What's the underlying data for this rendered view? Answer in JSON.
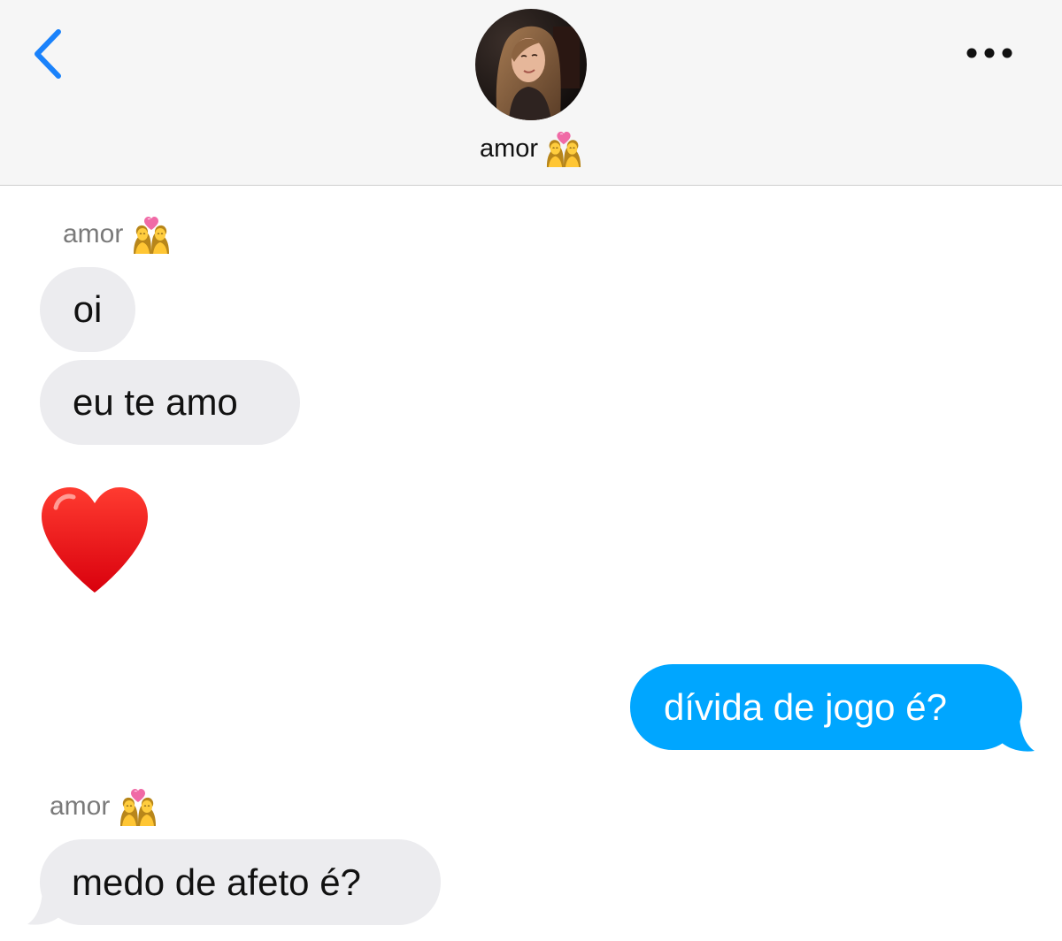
{
  "header": {
    "contact_name": "amor",
    "contact_emoji": "couple-with-heart-women-icon",
    "back_icon": "chevron-left-icon",
    "more_icon": "ellipsis-icon",
    "accent_color": "#1a82fb"
  },
  "messages": [
    {
      "sender": "amor",
      "direction": "incoming",
      "text": "oi"
    },
    {
      "sender": "amor",
      "direction": "incoming",
      "text": "eu te amo"
    },
    {
      "sender": "amor",
      "direction": "incoming",
      "emoji": "red-heart-icon"
    },
    {
      "sender": "me",
      "direction": "outgoing",
      "text": "dívida de jogo é?"
    },
    {
      "sender": "amor",
      "direction": "incoming",
      "text": "medo de afeto é?"
    }
  ],
  "labels": {
    "sender_1": "amor",
    "sender_2": "amor"
  },
  "colors": {
    "incoming_bubble": "#ececef",
    "outgoing_bubble": "#00a6ff",
    "header_bg": "#f6f6f6"
  }
}
